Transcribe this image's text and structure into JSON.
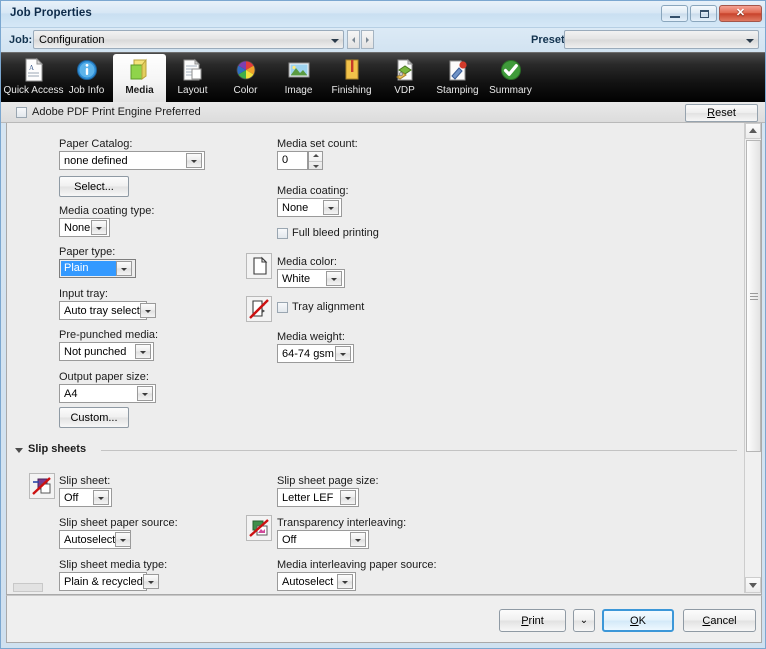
{
  "window": {
    "title": "Job Properties",
    "buttons": {
      "minimize": "minimize-icon",
      "maximize": "maximize-icon",
      "close": "✕"
    }
  },
  "jobbar": {
    "job_label": "Job:",
    "job_value": "Configuration",
    "prev_label": "‹",
    "next_label": "›",
    "presets_label": "Presets:",
    "presets_value": ""
  },
  "toolbar": {
    "tabs": [
      {
        "label": "Quick Access",
        "icon": "quick-access-icon",
        "active": false
      },
      {
        "label": "Job Info",
        "icon": "job-info-icon",
        "active": false
      },
      {
        "label": "Media",
        "icon": "media-icon",
        "active": true
      },
      {
        "label": "Layout",
        "icon": "layout-icon",
        "active": false
      },
      {
        "label": "Color",
        "icon": "color-wheel-icon",
        "active": false
      },
      {
        "label": "Image",
        "icon": "image-icon",
        "active": false
      },
      {
        "label": "Finishing",
        "icon": "finishing-icon",
        "active": false
      },
      {
        "label": "VDP",
        "icon": "vdp-icon",
        "active": false
      },
      {
        "label": "Stamping",
        "icon": "stamping-icon",
        "active": false
      },
      {
        "label": "Summary",
        "icon": "summary-check-icon",
        "active": false
      }
    ]
  },
  "adobe_bar": {
    "checkbox_label": "Adobe PDF Print Engine Preferred",
    "checked": false,
    "reset_label_u": "R",
    "reset_label_rest": "eset"
  },
  "media": {
    "paper_catalog_label": "Paper Catalog:",
    "paper_catalog_value": "none defined",
    "select_button": "Select...",
    "media_coating_type_label": "Media coating type:",
    "media_coating_type_value": "None",
    "paper_type_label": "Paper type:",
    "paper_type_value": "Plain",
    "input_tray_label": "Input tray:",
    "input_tray_value": "Auto tray select",
    "pre_punched_label": "Pre-punched media:",
    "pre_punched_value": "Not punched",
    "output_paper_size_label": "Output paper size:",
    "output_paper_size_value": "A4",
    "custom_button": "Custom...",
    "media_set_count_label": "Media set count:",
    "media_set_count_value": "0",
    "media_coating_label": "Media coating:",
    "media_coating_value": "None",
    "full_bleed_label": "Full bleed printing",
    "full_bleed_checked": false,
    "media_color_label": "Media color:",
    "media_color_value": "White",
    "tray_alignment_label": "Tray alignment",
    "tray_alignment_checked": false,
    "media_weight_label": "Media weight:",
    "media_weight_value": "64-74 gsm"
  },
  "slip_sheets": {
    "section_title": "Slip sheets",
    "slip_sheet_label": "Slip sheet:",
    "slip_sheet_value": "Off",
    "paper_source_label": "Slip sheet paper source:",
    "paper_source_value": "Autoselect",
    "media_type_label": "Slip sheet media type:",
    "media_type_value": "Plain & recycled",
    "page_size_label": "Slip sheet page size:",
    "page_size_value": "Letter LEF",
    "transparency_label": "Transparency interleaving:",
    "transparency_value": "Off",
    "interleaving_source_label": "Media interleaving paper source:",
    "interleaving_source_value": "Autoselect"
  },
  "footer": {
    "print_u": "P",
    "print_rest": "rint",
    "more_label": "⌄",
    "ok_u": "O",
    "ok_rest": "K",
    "cancel_u": "C",
    "cancel_rest": "ancel"
  },
  "colors": {
    "accent": "#3399ff",
    "default_button_border": "#3c97d8",
    "titlebar": "#d7e7f5",
    "toolbar_bg": "#121212",
    "close_button": "#c8432c"
  }
}
